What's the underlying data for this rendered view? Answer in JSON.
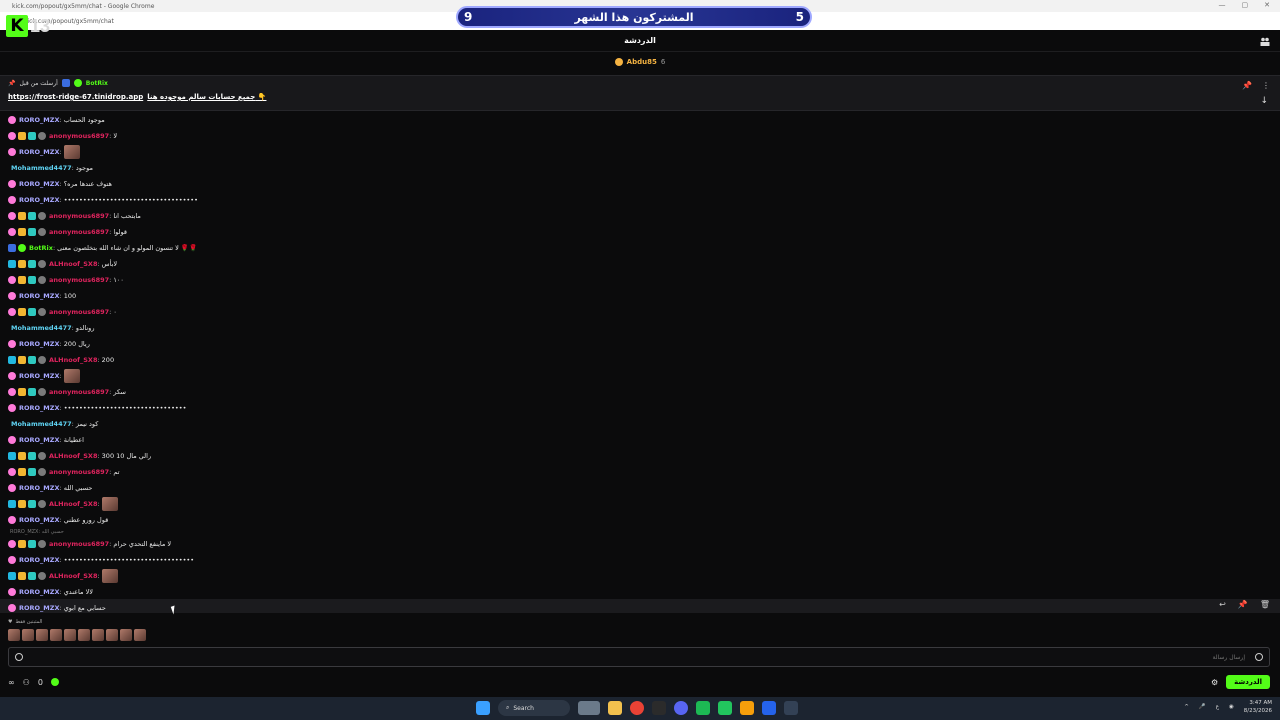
{
  "window": {
    "title": "kick.com/popout/gx5mm/chat - Google Chrome",
    "url": "kick.com/popout/gx5mm/chat"
  },
  "overlay": {
    "logo_letter": "K",
    "logo_number": "13",
    "banner_left": "9",
    "banner_text": "المشتركون هذا الشهر",
    "banner_right": "5"
  },
  "header": {
    "title": "الدردشة"
  },
  "gifter": {
    "name": "Abdu85",
    "count": "6"
  },
  "pinned": {
    "by_label": "أرسلت من قبل",
    "by_user": "BotRix",
    "message": "جميع حسابات سالم موجوده هنا 👇",
    "link": "https://frost-ridge-67.tinidrop.app"
  },
  "messages": [
    {
      "user": "RORO_MZX",
      "cls": "u-roro",
      "badges": [
        "b-pink"
      ],
      "text": "موجود الحساب"
    },
    {
      "user": "anonymous6897",
      "cls": "u-anon",
      "badges": [
        "b-pink",
        "b-gold",
        "b-teal",
        "b-gray"
      ],
      "text": "لا"
    },
    {
      "user": "RORO_MZX",
      "cls": "u-roro",
      "badges": [
        "b-pink"
      ],
      "text": "",
      "emote": true
    },
    {
      "user": "Mohammed4477",
      "cls": "u-moh",
      "badges": [],
      "text": "موجود"
    },
    {
      "user": "RORO_MZX",
      "cls": "u-roro",
      "badges": [
        "b-pink"
      ],
      "text": "هتوف عندها مره؟"
    },
    {
      "user": "RORO_MZX",
      "cls": "u-roro",
      "badges": [
        "b-pink"
      ],
      "text": "•••••••••••••••••••••••••••••••••••"
    },
    {
      "user": "anonymous6897",
      "cls": "u-anon",
      "badges": [
        "b-pink",
        "b-gold",
        "b-teal",
        "b-gray"
      ],
      "text": "مابتحب انا"
    },
    {
      "user": "anonymous6897",
      "cls": "u-anon",
      "badges": [
        "b-pink",
        "b-gold",
        "b-teal",
        "b-gray"
      ],
      "text": "قولوا"
    },
    {
      "user": "BotRix",
      "cls": "u-bot",
      "badges": [
        "b-blue",
        "b-green"
      ],
      "text": "لا تنسون المولو و ان شاء الله بتخلصون معنى 🌹🌹"
    },
    {
      "user": "ALHnoof_SX8",
      "cls": "u-alh",
      "badges": [
        "b-cyan",
        "b-gold",
        "b-teal",
        "b-gray"
      ],
      "text": "لابأس"
    },
    {
      "user": "anonymous6897",
      "cls": "u-anon",
      "badges": [
        "b-pink",
        "b-gold",
        "b-teal",
        "b-gray"
      ],
      "text": "١٠٠"
    },
    {
      "user": "RORO_MZX",
      "cls": "u-roro",
      "badges": [
        "b-pink"
      ],
      "text": "100"
    },
    {
      "user": "anonymous6897",
      "cls": "u-anon",
      "badges": [
        "b-pink",
        "b-gold",
        "b-teal",
        "b-gray"
      ],
      "text": "٠"
    },
    {
      "user": "Mohammed4477",
      "cls": "u-moh",
      "badges": [],
      "text": "رونالدو"
    },
    {
      "user": "RORO_MZX",
      "cls": "u-roro",
      "badges": [
        "b-pink"
      ],
      "text": "200 ريال"
    },
    {
      "user": "ALHnoof_SX8",
      "cls": "u-alh",
      "badges": [
        "b-cyan",
        "b-gold",
        "b-teal",
        "b-gray"
      ],
      "text": "200"
    },
    {
      "user": "RORO_MZX",
      "cls": "u-roro",
      "badges": [
        "b-pink"
      ],
      "text": "",
      "emote": true
    },
    {
      "user": "anonymous6897",
      "cls": "u-anon",
      "badges": [
        "b-pink",
        "b-gold",
        "b-teal",
        "b-gray"
      ],
      "text": "سكر"
    },
    {
      "user": "RORO_MZX",
      "cls": "u-roro",
      "badges": [
        "b-pink"
      ],
      "text": "••••••••••••••••••••••••••••••••"
    },
    {
      "user": "Mohammed4477",
      "cls": "u-moh",
      "badges": [],
      "text": "كود نيمز"
    },
    {
      "user": "RORO_MZX",
      "cls": "u-roro",
      "badges": [
        "b-pink"
      ],
      "text": "اعطيانة"
    },
    {
      "user": "ALHnoof_SX8",
      "cls": "u-alh",
      "badges": [
        "b-cyan",
        "b-gold",
        "b-teal",
        "b-gray"
      ],
      "text": "300 10 رالي مال"
    },
    {
      "user": "anonymous6897",
      "cls": "u-anon",
      "badges": [
        "b-pink",
        "b-gold",
        "b-teal",
        "b-gray"
      ],
      "text": "تم"
    },
    {
      "user": "RORO_MZX",
      "cls": "u-roro",
      "badges": [
        "b-pink"
      ],
      "text": "حسبي الله"
    },
    {
      "user": "ALHnoof_SX8",
      "cls": "u-alh",
      "badges": [
        "b-cyan",
        "b-gold",
        "b-teal",
        "b-gray"
      ],
      "text": "",
      "emote": true
    },
    {
      "user": "RORO_MZX",
      "cls": "u-roro",
      "badges": [
        "b-pink"
      ],
      "text": "قول رورو عطني"
    },
    {
      "reply": "RORO_MZX: حسبي الله"
    },
    {
      "user": "anonymous6897",
      "cls": "u-anon",
      "badges": [
        "b-pink",
        "b-gold",
        "b-teal",
        "b-gray"
      ],
      "text": "لا ماينفع التحدي حرام"
    },
    {
      "user": "RORO_MZX",
      "cls": "u-roro",
      "badges": [
        "b-pink"
      ],
      "text": "••••••••••••••••••••••••••••••••••"
    },
    {
      "user": "ALHnoof_SX8",
      "cls": "u-alh",
      "badges": [
        "b-cyan",
        "b-gold",
        "b-teal",
        "b-gray"
      ],
      "text": "",
      "emote": true
    },
    {
      "user": "RORO_MZX",
      "cls": "u-roro",
      "badges": [
        "b-pink"
      ],
      "text": "لالا ماعندي"
    },
    {
      "user": "RORO_MZX",
      "cls": "u-roro",
      "badges": [
        "b-pink"
      ],
      "text": "حسابي مع ابوي"
    }
  ],
  "recent": {
    "label": "المثبتين فقط"
  },
  "input": {
    "placeholder": "إرسال رسالة"
  },
  "footer": {
    "count": "0",
    "chat_button": "الدردشة"
  },
  "taskbar": {
    "search": "Search",
    "time": "3:47 AM",
    "date": "8/23/2026"
  },
  "icons": [
    "people-icon",
    "pin-icon",
    "more-icon",
    "arrow-down-icon",
    "reply-icon",
    "trash-icon",
    "smile-icon",
    "gear-icon",
    "infinity-icon",
    "windows-icon",
    "search-icon",
    "chrome-icon",
    "folder-icon"
  ]
}
